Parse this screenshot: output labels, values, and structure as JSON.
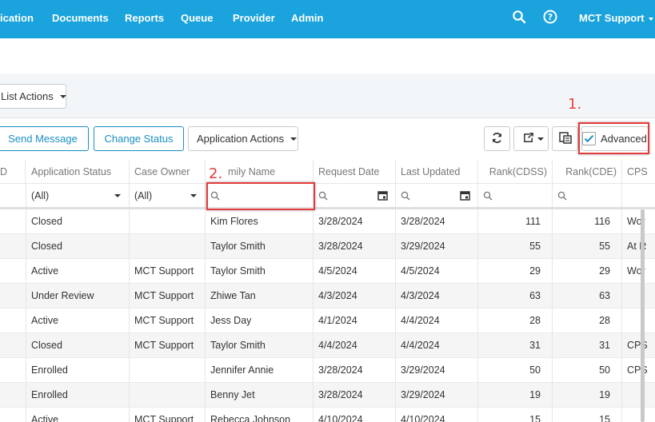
{
  "nav": {
    "items": [
      "ication",
      "Documents",
      "Reports",
      "Queue",
      "Provider",
      "Admin"
    ],
    "user": "MCT Support"
  },
  "list_actions": {
    "label": "List Actions"
  },
  "toolbar": {
    "send_message": "Send Message",
    "change_status": "Change Status",
    "application_actions": "Application Actions",
    "advanced_label": "Advanced",
    "advanced_checked": true
  },
  "annotations": {
    "step1": "1.",
    "step2": "2."
  },
  "grid": {
    "columns": [
      "D",
      "Application Status",
      "Case Owner",
      "mily Name",
      "Request Date",
      "Last Updated",
      "Rank(CDSS)",
      "Rank(CDE)",
      "CPS"
    ],
    "filters": {
      "status": "(All)",
      "owner": "(All)"
    },
    "rows": [
      [
        "Closed",
        "",
        "Kim Flores",
        "3/28/2024",
        "3/28/2024",
        "111",
        "116",
        "Wor"
      ],
      [
        "Closed",
        "",
        "Taylor Smith",
        "3/28/2024",
        "3/29/2024",
        "55",
        "55",
        "At R"
      ],
      [
        "Active",
        "MCT Support",
        "Taylor Smith",
        "4/5/2024",
        "4/5/2024",
        "29",
        "29",
        "Wor"
      ],
      [
        "Under Review",
        "MCT Support",
        "Zhiwe Tan",
        "4/3/2024",
        "4/3/2024",
        "63",
        "63",
        ""
      ],
      [
        "Active",
        "MCT Support",
        "Jess Day",
        "4/1/2024",
        "4/4/2024",
        "28",
        "28",
        ""
      ],
      [
        "Closed",
        "MCT Support",
        "Taylor Smith",
        "4/4/2024",
        "4/4/2024",
        "31",
        "31",
        "CPS"
      ],
      [
        "Enrolled",
        "",
        "Jennifer Annie",
        "3/28/2024",
        "3/29/2024",
        "50",
        "50",
        "CPS"
      ],
      [
        "Enrolled",
        "",
        "Benny Jet",
        "3/28/2024",
        "3/29/2024",
        "19",
        "19",
        ""
      ],
      [
        "Active",
        "MCT Support",
        "Rebecca Johnson",
        "4/10/2024",
        "4/10/2024",
        "15",
        "15",
        ""
      ]
    ]
  }
}
